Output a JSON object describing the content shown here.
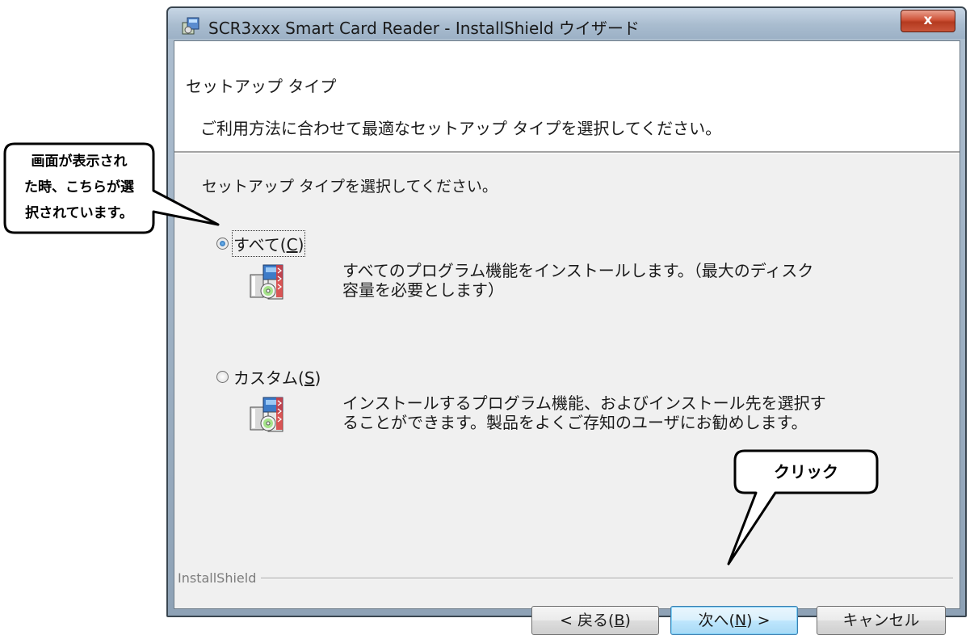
{
  "window": {
    "title": "SCR3xxx Smart Card Reader - InstallShield ウイザード",
    "close_label": "x"
  },
  "header": {
    "title": "セットアップ タイプ",
    "description": "ご利用方法に合わせて最適なセットアップ タイプを選択してください。"
  },
  "content": {
    "prompt": "セットアップ タイプを選択してください。",
    "options": [
      {
        "label_prefix": "すべて(",
        "mnemonic": "C",
        "label_suffix": ")",
        "selected": true,
        "description_line1": "すべてのプログラム機能をインストールします。（最大のディスク",
        "description_line2": "容量を必要とします）",
        "icon": "setup-package-icon"
      },
      {
        "label_prefix": "カスタム(",
        "mnemonic": "S",
        "label_suffix": ")",
        "selected": false,
        "description_line1": "インストールするプログラム機能、およびインストール先を選択す",
        "description_line2": "ることができます。製品をよくご存知のユーザにお勧めします。",
        "icon": "setup-package-icon"
      }
    ]
  },
  "footer": {
    "brand": "InstallShield",
    "back": {
      "prefix": "< 戻る(",
      "mnemonic": "B",
      "suffix": ")"
    },
    "next": {
      "prefix": "次へ(",
      "mnemonic": "N",
      "suffix": ") >"
    },
    "cancel": "キャンセル"
  },
  "callouts": {
    "left": {
      "line1": "画面が表示され",
      "line2": "た時、こちらが選",
      "line3": "択されています。"
    },
    "right": {
      "text": "クリック"
    }
  },
  "colors": {
    "accent_radio": "#1d5fa6",
    "close_button": "#c9553a",
    "default_button": "#a7d9f5"
  }
}
